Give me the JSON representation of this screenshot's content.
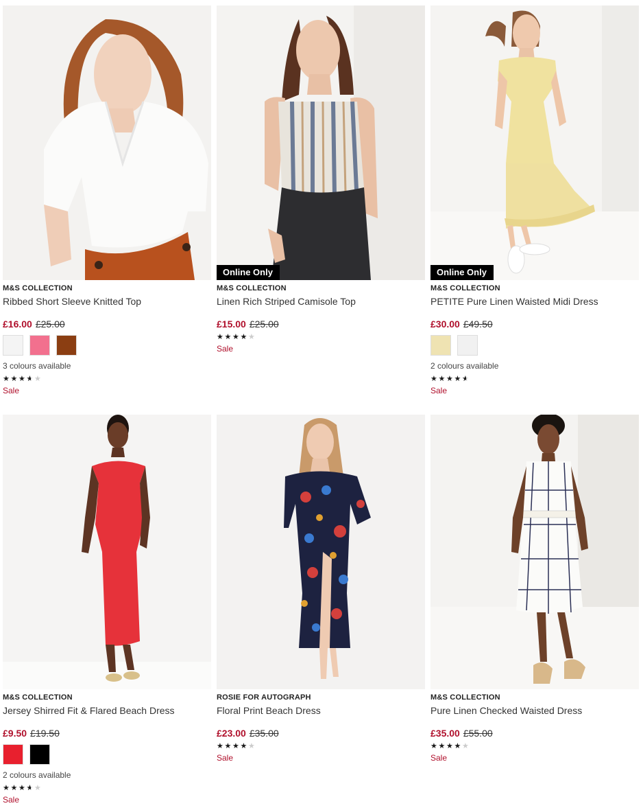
{
  "products": [
    {
      "brand": "M&S COLLECTION",
      "title": "Ribbed Short Sleeve Knitted Top",
      "badge": "",
      "price_now": "£16.00",
      "price_was": "£25.00",
      "swatches": [
        "#f4f4f4",
        "#f2708e",
        "#8b3e12"
      ],
      "colours_text": "3 colours available",
      "rating": 3.5,
      "sale": "Sale"
    },
    {
      "brand": "M&S COLLECTION",
      "title": "Linen Rich Striped Camisole Top",
      "badge": "Online Only",
      "price_now": "£15.00",
      "price_was": "£25.00",
      "swatches": [],
      "colours_text": "",
      "rating": 4,
      "sale": "Sale"
    },
    {
      "brand": "M&S COLLECTION",
      "title": "PETITE Pure Linen Waisted Midi Dress",
      "badge": "Online Only",
      "price_now": "£30.00",
      "price_was": "£49.50",
      "swatches": [
        "#efe3b2",
        "#f1f1f1"
      ],
      "colours_text": "2 colours available",
      "rating": 4.5,
      "sale": "Sale"
    },
    {
      "brand": "M&S COLLECTION",
      "title": "Jersey Shirred Fit & Flared Beach Dress",
      "badge": "",
      "price_now": "£9.50",
      "price_was": "£19.50",
      "swatches": [
        "#e8202e",
        "#000000"
      ],
      "colours_text": "2 colours available",
      "rating": 3.5,
      "sale": "Sale"
    },
    {
      "brand": "ROSIE FOR AUTOGRAPH",
      "title": "Floral Print Beach Dress",
      "badge": "",
      "price_now": "£23.00",
      "price_was": "£35.00",
      "swatches": [],
      "colours_text": "",
      "rating": 4,
      "sale": "Sale"
    },
    {
      "brand": "M&S COLLECTION",
      "title": "Pure Linen Checked Waisted Dress",
      "badge": "",
      "price_now": "£35.00",
      "price_was": "£55.00",
      "swatches": [],
      "colours_text": "",
      "rating": 4,
      "sale": "Sale"
    }
  ]
}
